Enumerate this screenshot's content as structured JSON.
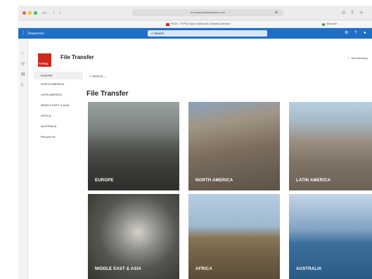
{
  "browser": {
    "url": "e.sharepoint.thelapoint.com",
    "bookmark_tab": "PAGE - TYPSA Sign-In (Microsoft, Outlook/Calendar)",
    "bookmark_right": "Microsoft"
  },
  "suite_bar": {
    "app_name": "SharePoint",
    "search_placeholder": "Search"
  },
  "site": {
    "logo_text": "TYPSA",
    "title": "File Transfer",
    "follow_label": "Not following"
  },
  "left_nav": {
    "items": [
      {
        "label": "EUROPE"
      },
      {
        "label": "NORTH AMERICA"
      },
      {
        "label": "LATIN AMERICA"
      },
      {
        "label": "MIDDLE EAST & ASIA"
      },
      {
        "label": "AFRICA"
      },
      {
        "label": "AUSTRALIA"
      },
      {
        "label": "Recycle bin"
      }
    ]
  },
  "content": {
    "send_to_label": "Send to",
    "title": "File Transfer",
    "tiles": [
      {
        "label": "EUROPE"
      },
      {
        "label": "NORTH AMERICA"
      },
      {
        "label": "LATIN AMERICA"
      },
      {
        "label": "MIDDLE EAST & ASIA"
      },
      {
        "label": "AFRICA"
      },
      {
        "label": "AUSTRALIA"
      }
    ]
  },
  "colors": {
    "suite_bar": "#1f6fc6",
    "brand_red": "#d0281f"
  }
}
